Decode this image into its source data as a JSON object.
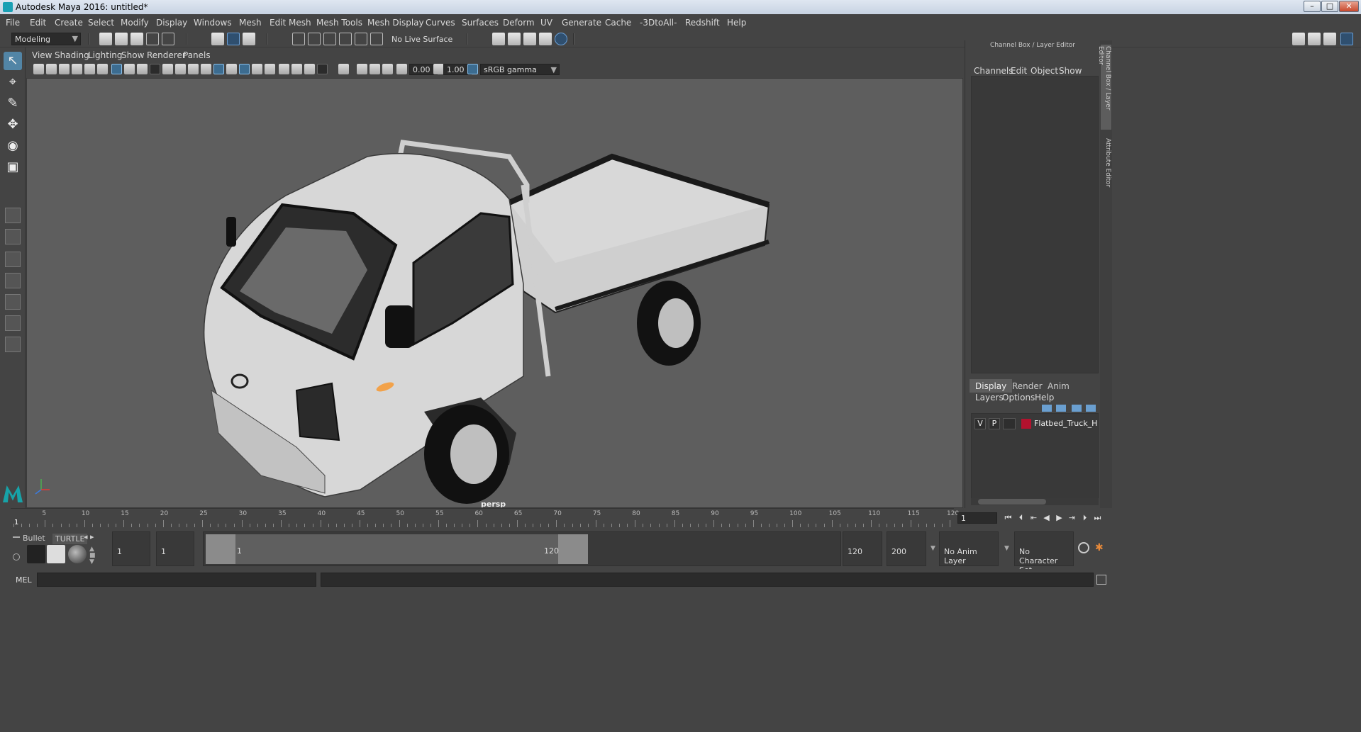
{
  "window": {
    "title": "Autodesk Maya 2016: untitled*"
  },
  "menu": [
    "File",
    "Edit",
    "Create",
    "Select",
    "Modify",
    "Display",
    "Windows",
    "Mesh",
    "Edit Mesh",
    "Mesh Tools",
    "Mesh Display",
    "Curves",
    "Surfaces",
    "Deform",
    "UV",
    "Generate",
    "Cache",
    "-3DtoAll-",
    "Redshift",
    "Help"
  ],
  "status": {
    "mode": "Modeling",
    "live_surface": "No Live Surface"
  },
  "viewport": {
    "menu": [
      "View",
      "Shading",
      "Lighting",
      "Show",
      "Renderer",
      "Panels"
    ],
    "exposure": "0.00",
    "gamma": "1.00",
    "color_space": "sRGB gamma",
    "camera": "persp"
  },
  "channel_box": {
    "header": "Channel Box / Layer Editor",
    "menu": [
      "Channels",
      "Edit",
      "Object",
      "Show"
    ],
    "tabs": [
      "Display",
      "Render",
      "Anim"
    ],
    "layer_menu": [
      "Layers",
      "Options",
      "Help"
    ],
    "layer": {
      "v": "V",
      "p": "P",
      "name": "Flatbed_Truck_Hyundai_l",
      "color": "#b3122e"
    }
  },
  "side_tabs": [
    "Channel Box / Layer Editor",
    "Attribute Editor"
  ],
  "timeline": {
    "ticks": [
      "5",
      "10",
      "15",
      "20",
      "25",
      "30",
      "35",
      "40",
      "45",
      "50",
      "55",
      "60",
      "65",
      "70",
      "75",
      "80",
      "85",
      "90",
      "95",
      "100",
      "105",
      "110",
      "115",
      "120"
    ],
    "current_frame_marker": "1",
    "current_frame": "1"
  },
  "shelf": {
    "tabs": [
      "Bullet",
      "TURTLE"
    ]
  },
  "range": {
    "start": "1",
    "playback_start": "1",
    "range_start_label": "1",
    "range_end_label": "120",
    "playback_end": "120",
    "end": "200",
    "anim_layer": "No Anim Layer",
    "character_set": "No Character Set"
  },
  "command": {
    "language": "MEL"
  }
}
